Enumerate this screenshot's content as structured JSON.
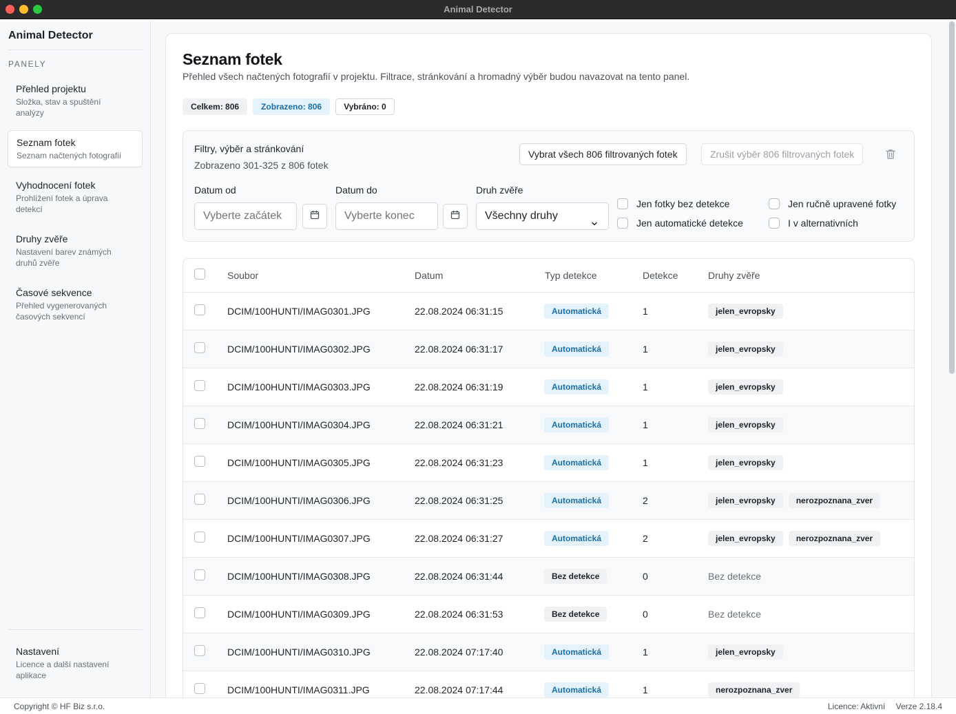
{
  "window": {
    "title": "Animal Detector"
  },
  "sidebar": {
    "app_name": "Animal Detector",
    "section_label": "PANELY",
    "items": [
      {
        "title": "Přehled projektu",
        "subtitle": "Složka, stav a spuštění analýzy"
      },
      {
        "title": "Seznam fotek",
        "subtitle": "Seznam načtených fotografií"
      },
      {
        "title": "Vyhodnocení fotek",
        "subtitle": "Prohlížení fotek a úprava detekcí"
      },
      {
        "title": "Druhy zvěře",
        "subtitle": "Nastavení barev známých druhů zvěře"
      },
      {
        "title": "Časové sekvence",
        "subtitle": "Přehled vygenerovaných časových sekvencí"
      }
    ],
    "settings": {
      "title": "Nastavení",
      "subtitle": "Licence a další nastavení aplikace"
    }
  },
  "page": {
    "title": "Seznam fotek",
    "description": "Přehled všech načtených fotografií v projektu. Filtrace, stránkování a hromadný výběr budou navazovat na tento panel.",
    "badges": {
      "total": "Celkem: 806",
      "shown": "Zobrazeno: 806",
      "selected": "Vybráno: 0"
    }
  },
  "filters": {
    "title": "Filtry, výběr a stránkování",
    "range": "Zobrazeno 301-325 z 806 fotek",
    "select_all_label": "Vybrat všech 806 filtrovaných fotek",
    "clear_label": "Zrušit výběr 806 filtrovaných fotek",
    "date_from_label": "Datum od",
    "date_from_placeholder": "Vyberte začátek",
    "date_to_label": "Datum do",
    "date_to_placeholder": "Vyberte konec",
    "species_label": "Druh zvěře",
    "species_value": "Všechny druhy",
    "checkboxes": {
      "no_detection": "Jen fotky bez detekce",
      "auto_only": "Jen automatické detekce",
      "manual_only": "Jen ručně upravené fotky",
      "alternative": "I v alternativních"
    }
  },
  "table": {
    "headers": {
      "file": "Soubor",
      "date": "Datum",
      "type": "Typ detekce",
      "count": "Detekce",
      "species": "Druhy zvěře"
    },
    "rows": [
      {
        "file": "DCIM/100HUNTI/IMAG0301.JPG",
        "date": "22.08.2024 06:31:15",
        "type": "Automatická",
        "count": "1",
        "species": [
          "jelen_evropsky"
        ]
      },
      {
        "file": "DCIM/100HUNTI/IMAG0302.JPG",
        "date": "22.08.2024 06:31:17",
        "type": "Automatická",
        "count": "1",
        "species": [
          "jelen_evropsky"
        ]
      },
      {
        "file": "DCIM/100HUNTI/IMAG0303.JPG",
        "date": "22.08.2024 06:31:19",
        "type": "Automatická",
        "count": "1",
        "species": [
          "jelen_evropsky"
        ]
      },
      {
        "file": "DCIM/100HUNTI/IMAG0304.JPG",
        "date": "22.08.2024 06:31:21",
        "type": "Automatická",
        "count": "1",
        "species": [
          "jelen_evropsky"
        ]
      },
      {
        "file": "DCIM/100HUNTI/IMAG0305.JPG",
        "date": "22.08.2024 06:31:23",
        "type": "Automatická",
        "count": "1",
        "species": [
          "jelen_evropsky"
        ]
      },
      {
        "file": "DCIM/100HUNTI/IMAG0306.JPG",
        "date": "22.08.2024 06:31:25",
        "type": "Automatická",
        "count": "2",
        "species": [
          "jelen_evropsky",
          "nerozpoznana_zver"
        ]
      },
      {
        "file": "DCIM/100HUNTI/IMAG0307.JPG",
        "date": "22.08.2024 06:31:27",
        "type": "Automatická",
        "count": "2",
        "species": [
          "jelen_evropsky",
          "nerozpoznana_zver"
        ]
      },
      {
        "file": "DCIM/100HUNTI/IMAG0308.JPG",
        "date": "22.08.2024 06:31:44",
        "type": "Bez detekce",
        "count": "0",
        "species": [],
        "no_detection_text": "Bez detekce"
      },
      {
        "file": "DCIM/100HUNTI/IMAG0309.JPG",
        "date": "22.08.2024 06:31:53",
        "type": "Bez detekce",
        "count": "0",
        "species": [],
        "no_detection_text": "Bez detekce"
      },
      {
        "file": "DCIM/100HUNTI/IMAG0310.JPG",
        "date": "22.08.2024 07:17:40",
        "type": "Automatická",
        "count": "1",
        "species": [
          "jelen_evropsky"
        ]
      },
      {
        "file": "DCIM/100HUNTI/IMAG0311.JPG",
        "date": "22.08.2024 07:17:44",
        "type": "Automatická",
        "count": "1",
        "species": [
          "nerozpoznana_zver"
        ]
      }
    ]
  },
  "footer": {
    "copyright": "Copyright © HF Biz s.r.o.",
    "license": "Licence: Aktivní",
    "version": "Verze 2.18.4"
  },
  "colors": {
    "accent_bg": "#e3f2fb",
    "accent_text": "#1b6fa8",
    "titlebar": "#2b2b2b"
  },
  "icons": {
    "calendar": "calendar-icon",
    "trash": "trash-icon",
    "chevron": "chevron-down-icon"
  }
}
